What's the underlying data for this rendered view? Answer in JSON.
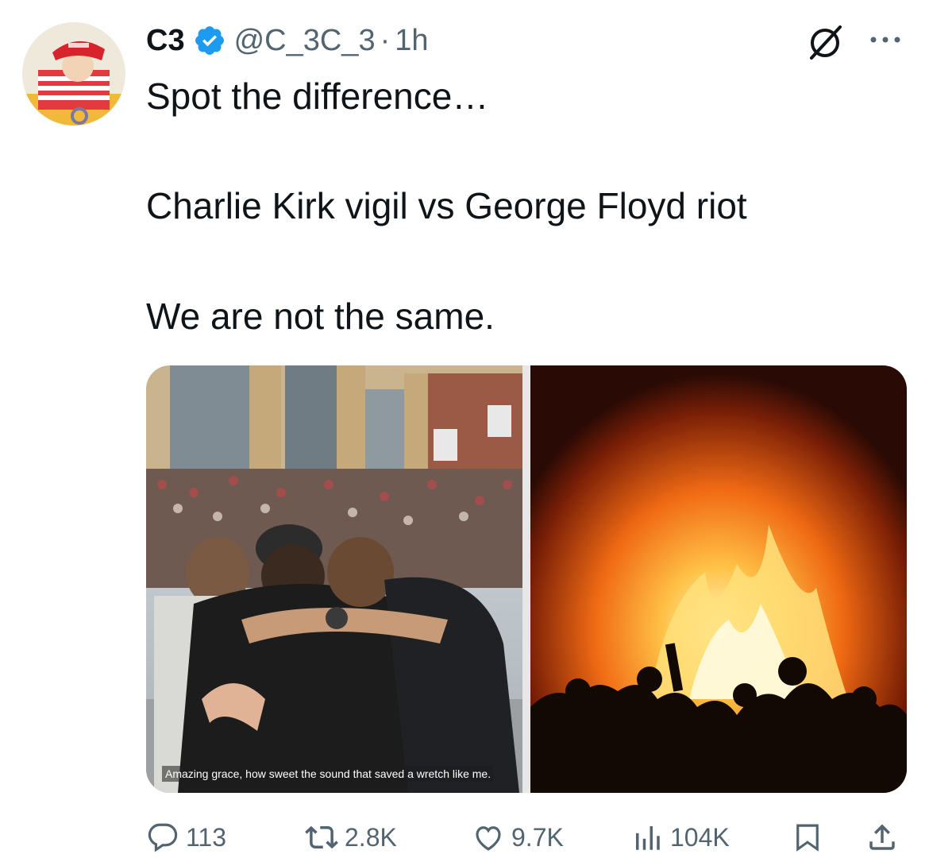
{
  "tweet": {
    "author_name": "C3",
    "handle": "@C_3C_3",
    "separator": "·",
    "time": "1h",
    "text_line1": "Spot the difference…",
    "text_line2": "Charlie Kirk vigil vs George Floyd riot",
    "text_line3": "We are not the same.",
    "media_caption": "Amazing grace, how sweet the sound that saved a wretch like me.",
    "verified": true
  },
  "actions": {
    "replies": "113",
    "reposts": "2.8K",
    "likes": "9.7K",
    "views": "104K"
  },
  "colors": {
    "verified_blue": "#1d9bf0",
    "secondary_text": "#536471",
    "primary_text": "#0f1419"
  },
  "icons": [
    "verified-badge-icon",
    "grok-icon",
    "more-icon",
    "reply-icon",
    "repost-icon",
    "like-icon",
    "views-icon",
    "bookmark-icon",
    "share-icon"
  ]
}
